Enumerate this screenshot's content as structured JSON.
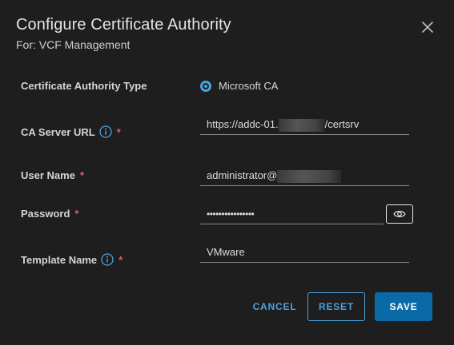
{
  "dialog": {
    "title": "Configure Certificate Authority",
    "subtitle": "For: VCF Management",
    "close_icon": "close-icon"
  },
  "form": {
    "ca_type": {
      "label": "Certificate Authority Type",
      "option": "Microsoft CA",
      "selected": true
    },
    "ca_server_url": {
      "label": "CA Server URL",
      "required_mark": "*",
      "value_prefix": "https://addc-01.",
      "value_suffix": "/certsrv"
    },
    "user_name": {
      "label": "User Name",
      "required_mark": "*",
      "value_prefix": "administrator@"
    },
    "password": {
      "label": "Password",
      "required_mark": "*",
      "value": "••••••••••••••••",
      "toggle_icon": "eye-icon"
    },
    "template_name": {
      "label": "Template Name",
      "required_mark": "*",
      "value": "VMware"
    }
  },
  "buttons": {
    "cancel": "CANCEL",
    "reset": "RESET",
    "save": "SAVE"
  },
  "colors": {
    "accent": "#4aa3df",
    "primary_button": "#0a6aa8",
    "required": "#e06060",
    "background": "#1e1e1e"
  }
}
